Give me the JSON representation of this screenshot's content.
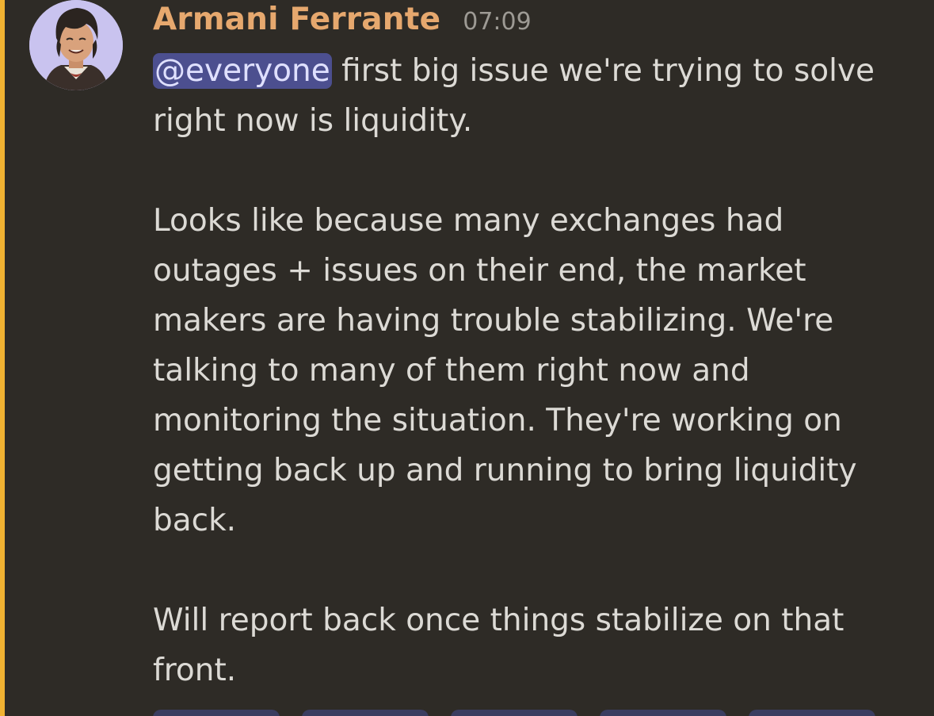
{
  "author": {
    "name": "Armani Ferrante",
    "timestamp": "07:09",
    "avatar_icon": "user-avatar",
    "name_color": "#e6a86e"
  },
  "message": {
    "mention": "@everyone",
    "line1_rest": " first big issue we're trying to solve right now is liquidity.",
    "paragraph2": "Looks like because many exchanges had outages + issues on their end, the market makers are having trouble stabilizing. We're talking to many of them right now and monitoring the situation. They're working on getting back up and running to bring liquidity back.",
    "paragraph3": "Will report back once things stabilize on that front."
  },
  "colors": {
    "background": "#2e2b26",
    "mention_bar": "#f0b232",
    "mention_bg": "#4c4f8f",
    "text": "#dcdad5",
    "timestamp": "#9d9a94"
  }
}
